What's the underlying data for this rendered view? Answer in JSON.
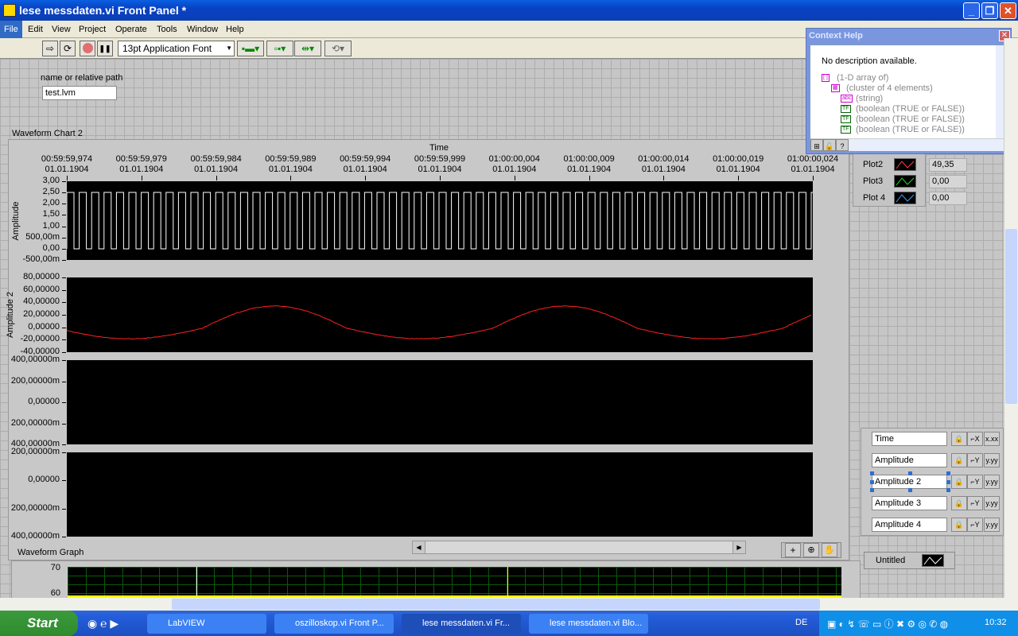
{
  "window": {
    "title": "lese messdaten.vi Front Panel *",
    "min": "_",
    "max": "❐",
    "close": "✕"
  },
  "menu": [
    "File",
    "Edit",
    "View",
    "Project",
    "Operate",
    "Tools",
    "Window",
    "Help"
  ],
  "toolbar": {
    "run": "⇨",
    "run_cont": "⟳",
    "pause": "❚❚",
    "font": "13pt Application Font",
    "font_arrow": "▼"
  },
  "path_control": {
    "label": "name or relative path",
    "value": "test.lvm"
  },
  "chart": {
    "label": "Waveform Chart 2",
    "xlabel": "Time",
    "xticks": [
      [
        "00:59:59,974",
        "01.01.1904"
      ],
      [
        "00:59:59,979",
        "01.01.1904"
      ],
      [
        "00:59:59,984",
        "01.01.1904"
      ],
      [
        "00:59:59,989",
        "01.01.1904"
      ],
      [
        "00:59:59,994",
        "01.01.1904"
      ],
      [
        "00:59:59,999",
        "01.01.1904"
      ],
      [
        "01:00:00,004",
        "01.01.1904"
      ],
      [
        "01:00:00,009",
        "01.01.1904"
      ],
      [
        "01:00:00,014",
        "01.01.1904"
      ],
      [
        "01:00:00,019",
        "01.01.1904"
      ],
      [
        "01:00:00,024",
        "01.01.1904"
      ]
    ],
    "plots": [
      {
        "ylabel": "Amplitude",
        "yticks": [
          "3,00",
          "2,50",
          "2,00",
          "1,50",
          "1,00",
          "500,00m",
          "0,00",
          "-500,00m"
        ],
        "color": "#ffffff"
      },
      {
        "ylabel": "Amplitude 2",
        "yticks": [
          "80,00000",
          "60,00000",
          "40,00000",
          "20,00000",
          "0,00000",
          "-20,00000",
          "-40,00000"
        ],
        "color": "#ff2020"
      },
      {
        "ylabel": "",
        "yticks": [
          "400,00000m",
          "200,00000m",
          "0,00000",
          "200,00000m",
          "400,00000m"
        ]
      },
      {
        "ylabel": "",
        "yticks": [
          "200,00000m",
          "0,00000",
          "200,00000m",
          "400,00000m"
        ]
      }
    ]
  },
  "plot_legend": [
    {
      "name": "Plot2",
      "value": "49,35",
      "color": "#ff4040"
    },
    {
      "name": "Plot3",
      "value": "0,00",
      "color": "#20e020"
    },
    {
      "name": "Plot 4",
      "value": "0,00",
      "color": "#40a0ff"
    }
  ],
  "scale_legend": [
    {
      "name": "Time",
      "axis": "X",
      "fmt": "x.xx"
    },
    {
      "name": "Amplitude",
      "axis": "Y",
      "fmt": "y.yy"
    },
    {
      "name": "Amplitude 2",
      "axis": "Y",
      "fmt": "y.yy"
    },
    {
      "name": "Amplitude 3",
      "axis": "Y",
      "fmt": "y.yy"
    },
    {
      "name": "Amplitude 4",
      "axis": "Y",
      "fmt": "y.yy"
    }
  ],
  "graph": {
    "label": "Waveform Graph",
    "yticks": [
      "70",
      "60"
    ],
    "legend": "Untitled"
  },
  "context_help": {
    "title": "Context Help",
    "desc": "No description available.",
    "tree": [
      [
        "[ ]",
        "(1-D array of)"
      ],
      [
        "▦",
        "(cluster of 4 elements)"
      ],
      [
        "abc",
        "(string)"
      ],
      [
        "TF",
        "(boolean (TRUE or FALSE))"
      ],
      [
        "TF",
        "(boolean (TRUE or FALSE))"
      ],
      [
        "TF",
        "(boolean (TRUE or FALSE))"
      ]
    ]
  },
  "taskbar": {
    "start": "Start",
    "tasks": [
      "LabVIEW",
      "oszilloskop.vi Front P...",
      "lese messdaten.vi Fr...",
      "lese messdaten.vi Blo..."
    ],
    "lang": "DE",
    "clock": "10:32"
  }
}
